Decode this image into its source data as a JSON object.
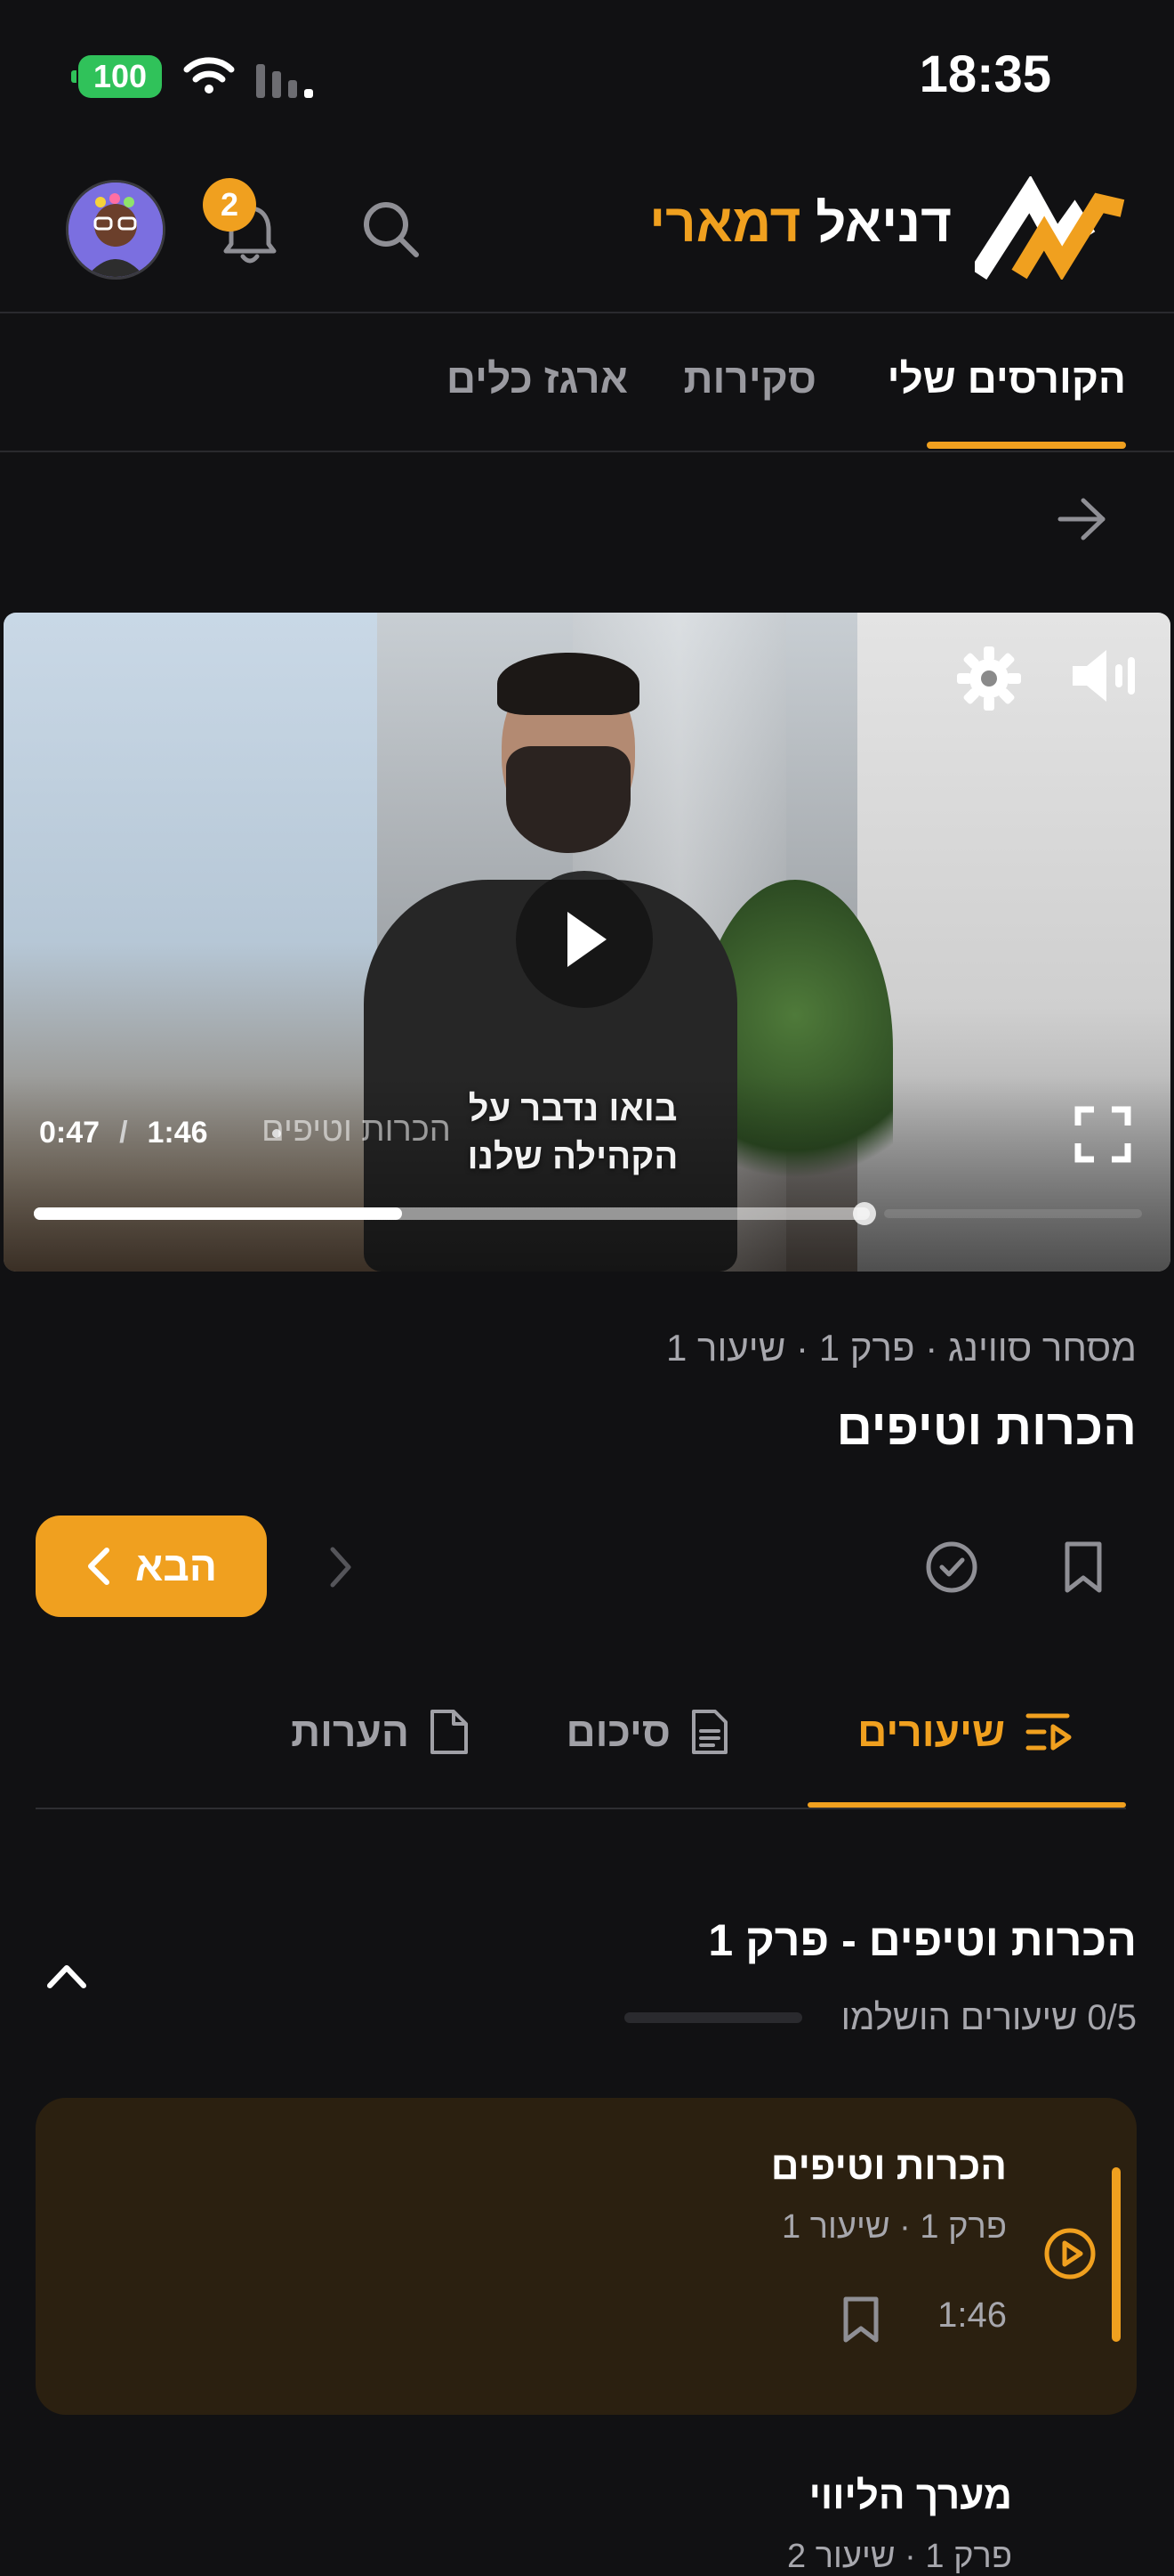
{
  "status_bar": {
    "time": "18:35",
    "battery": "100"
  },
  "header": {
    "brand_first": "דניאל",
    "brand_last": "דמארי",
    "notifications_count": "2"
  },
  "top_tabs": [
    {
      "label": "הקורסים שלי",
      "active": true
    },
    {
      "label": "סקירות",
      "active": false
    },
    {
      "label": "ארגז כלים",
      "active": false
    }
  ],
  "video": {
    "current_time": "0:47",
    "duration": "1:46",
    "title": "הכרות וטיפים",
    "overlay_text": "בואו נדבר על הקהילה שלנו",
    "progress_fraction": 0.44
  },
  "lesson": {
    "breadcrumb": "מסחר סווינג · פרק 1 · שיעור 1",
    "title": "הכרות וטיפים",
    "next_label": "הבא"
  },
  "content_tabs": [
    {
      "label": "שיעורים",
      "icon": "playlist-icon",
      "active": true
    },
    {
      "label": "סיכום",
      "icon": "document-icon",
      "active": false
    },
    {
      "label": "הערות",
      "icon": "note-icon",
      "active": false
    }
  ],
  "section": {
    "title": "הכרות וטיפים - פרק 1",
    "completed_text": "0/5 שיעורים הושלמו",
    "completed_fraction": 0
  },
  "lessons": [
    {
      "title": "הכרות וטיפים",
      "subtitle": "פרק 1 · שיעור 1",
      "duration": "1:46",
      "active": true
    },
    {
      "title": "מערך הליווי",
      "subtitle": "פרק 1 · שיעור 2",
      "active": false
    }
  ],
  "colors": {
    "accent": "#f0a01f",
    "background": "#111113",
    "card_active": "#2b2010"
  }
}
